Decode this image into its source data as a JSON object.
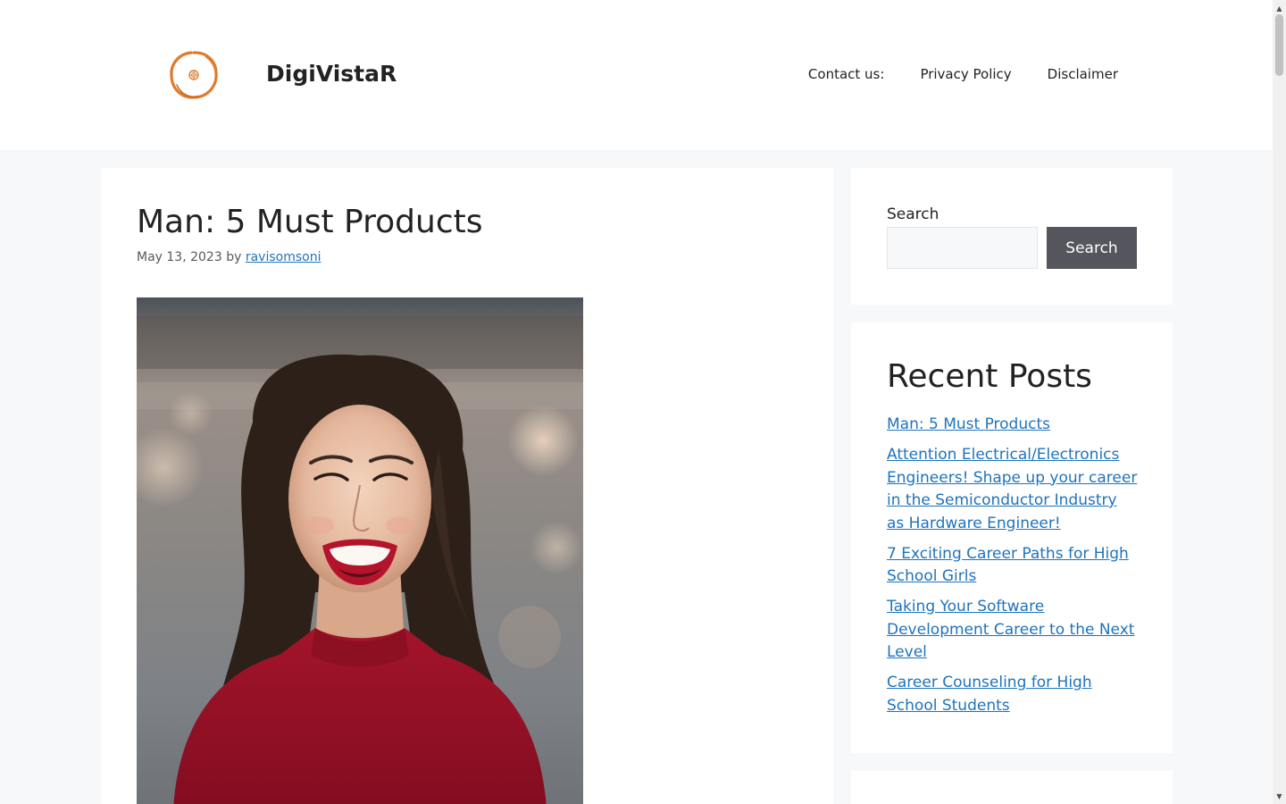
{
  "header": {
    "site_title": "DigiVistaR",
    "logo_icon": "orange-ring-logo-icon",
    "nav": [
      {
        "label": "Contact us:"
      },
      {
        "label": "Privacy Policy"
      },
      {
        "label": "Disclaimer"
      }
    ]
  },
  "article": {
    "title": "Man: 5 Must Products",
    "date": "May 13, 2023",
    "by": "by",
    "author": "ravisomsoni",
    "image_icon": "smiling-woman-photo"
  },
  "sidebar": {
    "search": {
      "label": "Search",
      "placeholder": "",
      "button_label": "Search"
    },
    "recent": {
      "title": "Recent Posts",
      "posts": [
        {
          "label": "Man: 5 Must Products"
        },
        {
          "label": "Attention Electrical/Electronics Engineers! Shape up your career in the Semiconductor Industry as Hardware Engineer!"
        },
        {
          "label": "7 Exciting Career Paths for High School Girls"
        },
        {
          "label": "Taking Your Software Development Career to the Next Level"
        },
        {
          "label": "Career Counseling for High School Students"
        }
      ]
    }
  },
  "colors": {
    "link": "#1e73be",
    "button": "#55555e",
    "page_bg": "#f7f8f9",
    "logo": "#e07b2e"
  }
}
